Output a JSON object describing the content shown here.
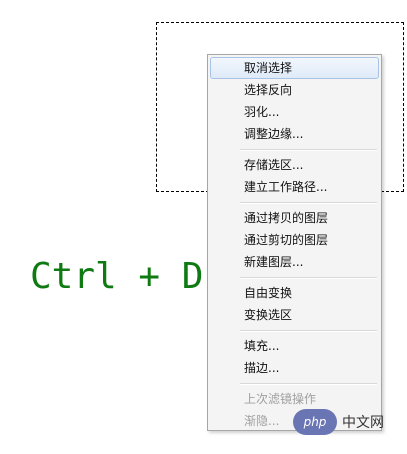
{
  "hotkey": "Ctrl + D",
  "menu": {
    "items": [
      {
        "label": "取消选择",
        "highlight": true
      },
      {
        "label": "选择反向"
      },
      {
        "label": "羽化..."
      },
      {
        "label": "调整边缘..."
      },
      {
        "separator": true
      },
      {
        "label": "存储选区..."
      },
      {
        "label": "建立工作路径..."
      },
      {
        "separator": true
      },
      {
        "label": "通过拷贝的图层"
      },
      {
        "label": "通过剪切的图层"
      },
      {
        "label": "新建图层..."
      },
      {
        "separator": true
      },
      {
        "label": "自由变换"
      },
      {
        "label": "变换选区"
      },
      {
        "separator": true
      },
      {
        "label": "填充..."
      },
      {
        "label": "描边..."
      },
      {
        "separator": true
      },
      {
        "label": "上次滤镜操作",
        "disabled": true
      },
      {
        "label": "渐隐...",
        "disabled": true
      }
    ]
  },
  "watermark": {
    "logo_text": "php",
    "site_text": "中文网"
  },
  "colors": {
    "hotkey": "#0f7a12",
    "menu_bg": "#f4f4f4",
    "highlight_border": "#a9c3e6",
    "disabled_text": "#a0a0a0"
  }
}
